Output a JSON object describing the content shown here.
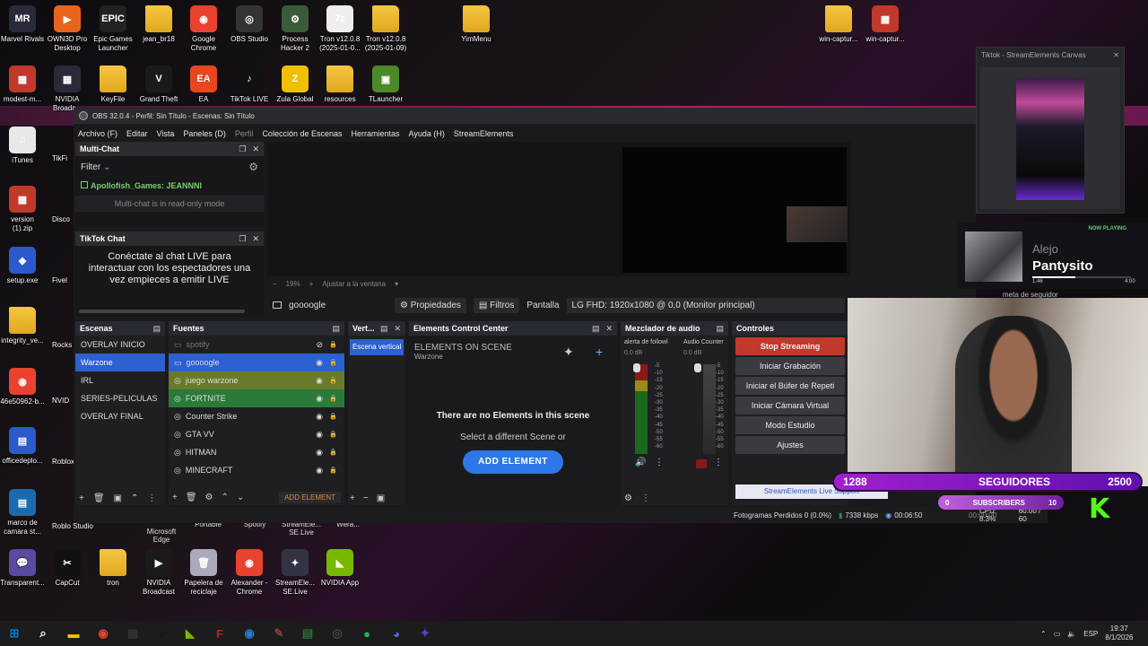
{
  "desktop_top": [
    {
      "label": "Marvel Rivals",
      "color": "#2a2a3a",
      "glyph": "MR"
    },
    {
      "label": "OWN3D Pro Desktop",
      "color": "#e8641c",
      "glyph": "▶"
    },
    {
      "label": "Epic Games Launcher",
      "color": "#222",
      "glyph": "EPIC"
    },
    {
      "label": "jean_br18",
      "color": "folder",
      "glyph": ""
    },
    {
      "label": "Google Chrome",
      "color": "#e9422f",
      "glyph": "◉"
    },
    {
      "label": "OBS Studio",
      "color": "#333",
      "glyph": "◎"
    },
    {
      "label": "Process Hacker 2",
      "color": "#3a5a3a",
      "glyph": "⚙"
    },
    {
      "label": "Tron v12.0.8 (2025-01-0...",
      "color": "#eee",
      "glyph": "7z"
    },
    {
      "label": "Tron v12.0.8 (2025-01-09)",
      "color": "folder",
      "glyph": ""
    },
    {
      "label": "YimMenu",
      "color": "folder",
      "glyph": ""
    },
    {
      "label": "win-captur...",
      "color": "folder",
      "glyph": ""
    },
    {
      "label": "win-captur...",
      "color": "#c0392b",
      "glyph": "▦"
    }
  ],
  "desktop_row2": [
    {
      "label": "modest-m...",
      "color": "#c0392b",
      "glyph": "▦"
    },
    {
      "label": "NVIDIA Broadc...",
      "color": "#2a2a3a",
      "glyph": "▦"
    },
    {
      "label": "KeyFile",
      "color": "folder",
      "glyph": ""
    },
    {
      "label": "Grand Theft",
      "color": "#1a1a1a",
      "glyph": "V"
    },
    {
      "label": "EA",
      "color": "#e8461c",
      "glyph": "EA"
    },
    {
      "label": "TikTok LIVE",
      "color": "#111",
      "glyph": "♪"
    },
    {
      "label": "Zula Global",
      "color": "#f0c000",
      "glyph": "Z"
    },
    {
      "label": "resources",
      "color": "folder",
      "glyph": ""
    },
    {
      "label": "TLauncher",
      "color": "#4a8a2a",
      "glyph": "▣"
    }
  ],
  "desktop_left": [
    {
      "label": "iTunes",
      "color": "#e8e8e8",
      "glyph": "♫"
    },
    {
      "label": "version (1).zip",
      "color": "#c0392b",
      "glyph": "▦"
    },
    {
      "label": "setup.exe",
      "color": "#2a5acc",
      "glyph": "◆"
    },
    {
      "label": "integrity_ve...",
      "color": "folder",
      "glyph": ""
    },
    {
      "label": "46e50962-b...",
      "color": "#e9422f",
      "glyph": "◉"
    },
    {
      "label": "officedeplo...",
      "color": "#2a5acc",
      "glyph": "▤"
    },
    {
      "label": "marco de camara st...",
      "color": "#1a6ab0",
      "glyph": "▤"
    },
    {
      "label": "Transparent...",
      "color": "#5a4aa0",
      "glyph": "💬"
    }
  ],
  "desktop_col2": [
    "TikFi",
    "Disco",
    "Fivel",
    "Rocks Game",
    "NVID",
    "Roblox I",
    "Roblo Studio"
  ],
  "desktop_bottom": [
    {
      "label": "CapCut",
      "color": "#111",
      "glyph": "✂"
    },
    {
      "label": "tron",
      "color": "folder",
      "glyph": ""
    },
    {
      "label": "NVIDIA Broadcast",
      "color": "#1a1a1a",
      "glyph": "▶"
    },
    {
      "label": "Papelera de reciclaje",
      "color": "#aab",
      "glyph": "🗑"
    },
    {
      "label": "Alexander - Chrome",
      "color": "#e9422f",
      "glyph": "◉"
    },
    {
      "label": "StreamEle... SE.Live",
      "color": "#334",
      "glyph": "✦"
    },
    {
      "label": "NVIDIA App",
      "color": "#76b900",
      "glyph": "◣"
    }
  ],
  "desktop_bottom_partial": [
    "Microsoft Edge",
    "Portable",
    "Spotify",
    "StreamEle... SE.Live",
    "Wera..."
  ],
  "obs": {
    "title": "OBS 32.0.4 - Perfil: Sin Título - Escenas: Sin Título",
    "menu": [
      "Archivo (F)",
      "Editar",
      "Vista",
      "Paneles (D)",
      "Perfil",
      "Colección de Escenas",
      "Herramientas",
      "Ayuda (H)",
      "StreamElements"
    ],
    "multichat": {
      "title": "Multi-Chat",
      "filter": "Filter",
      "message": "Apollofish_Games: JEANNNI",
      "readonly": "Multi-chat is in read-only mode"
    },
    "tiktok": {
      "title": "TikTok Chat",
      "message": "Conéctate al chat LIVE para interactuar con los espectadores una vez empieces a emitir LIVE"
    },
    "preview": {
      "zoom": "19%",
      "fit": "Ajustar a la ventana"
    },
    "source_bar": {
      "name": "goooogle",
      "props": "Propiedades",
      "filters": "Filtros",
      "screen_label": "Pantalla",
      "screen_value": "LG FHD: 1920x1080 @ 0,0 (Monitor principal)"
    },
    "scenes": {
      "title": "Escenas",
      "items": [
        "OVERLAY INICIO",
        "Warzone",
        "IRL",
        "SERIES-PELICULAS",
        "OVERLAY FINAL"
      ],
      "selected": 1
    },
    "sources": {
      "title": "Fuentes",
      "items": [
        "spotify",
        "goooogle",
        "juego warzone",
        "FORTNITE",
        "Counter Strike",
        "GTA VV",
        "HITMAN",
        "MINECRAFT"
      ],
      "add": "ADD ELEMENT"
    },
    "vert": {
      "title": "Vert...",
      "item": "Escena vertical"
    },
    "ecc": {
      "title": "Elements Control Center",
      "heading": "ELEMENTS ON SCENE",
      "scene": "Warzone",
      "empty": "There are no Elements in this scene",
      "hint": "Select a different Scene or",
      "add": "ADD ELEMENT"
    },
    "mixer": {
      "title": "Mezclador de audio",
      "ch1": "alerta de followl",
      "ch2": "Audio Counter",
      "db1": "0.0 dB",
      "db2": "0.0 dB",
      "scale": [
        "-5",
        "-10",
        "-15",
        "-20",
        "-25",
        "-30",
        "-35",
        "-40",
        "-45",
        "-50",
        "-55",
        "-60"
      ]
    },
    "controls": {
      "title": "Controles",
      "buttons": [
        "Stop Streaming",
        "Iniciar Grabación",
        "Iniciar el Búfer de Repeti",
        "Iniciar Cámara Virtual",
        "Modo Estudio",
        "Ajustes"
      ],
      "se": "StreamElements Live Support"
    },
    "status": {
      "frames": "Fotogramas Perdidos 0 (0.0%)",
      "kbps": "7338 kbps",
      "time": "00:06:50",
      "rec_time": "00:00:00",
      "cpu": "CPU: 8.3%",
      "fps": "60.00 / 60"
    }
  },
  "tiktok_canvas": {
    "title": "Tiktok - StreamElements Canvas"
  },
  "now_playing": {
    "badge": "NOW PLAYING",
    "artist": "Alejo",
    "song": "Pantysito",
    "elapsed": "1:46",
    "total": "4:00",
    "meta": "meta de seguidor"
  },
  "overlay": {
    "followers_current": "1288",
    "followers_label": "SEGUIDORES",
    "followers_goal": "2500",
    "subs_current": "0",
    "subs_label": "SUBSCRIBERS",
    "subs_goal": "10"
  },
  "taskbar": {
    "time": "19:37",
    "date": "8/1/2026",
    "lang": "ESP"
  }
}
